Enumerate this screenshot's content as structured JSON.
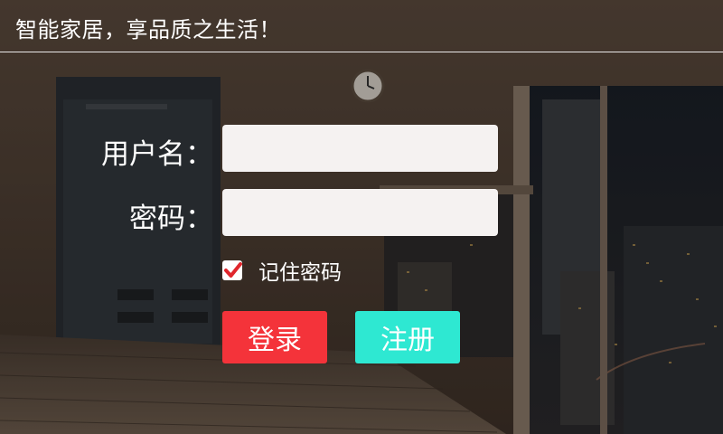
{
  "header": {
    "title": "智能家居，享品质之生活！"
  },
  "form": {
    "username_label": "用户名：",
    "password_label": "密码：",
    "username_value": "",
    "password_value": "",
    "remember_label": "记住密码",
    "remember_checked": true,
    "login_label": "登录",
    "register_label": "注册"
  },
  "colors": {
    "login": "#f4333a",
    "register": "#2ee8d2",
    "checkmark": "#e0262c",
    "input_bg": "#f5f2f1"
  },
  "icons": {
    "checkbox": "checkmark-icon",
    "clock": "wall-clock"
  }
}
